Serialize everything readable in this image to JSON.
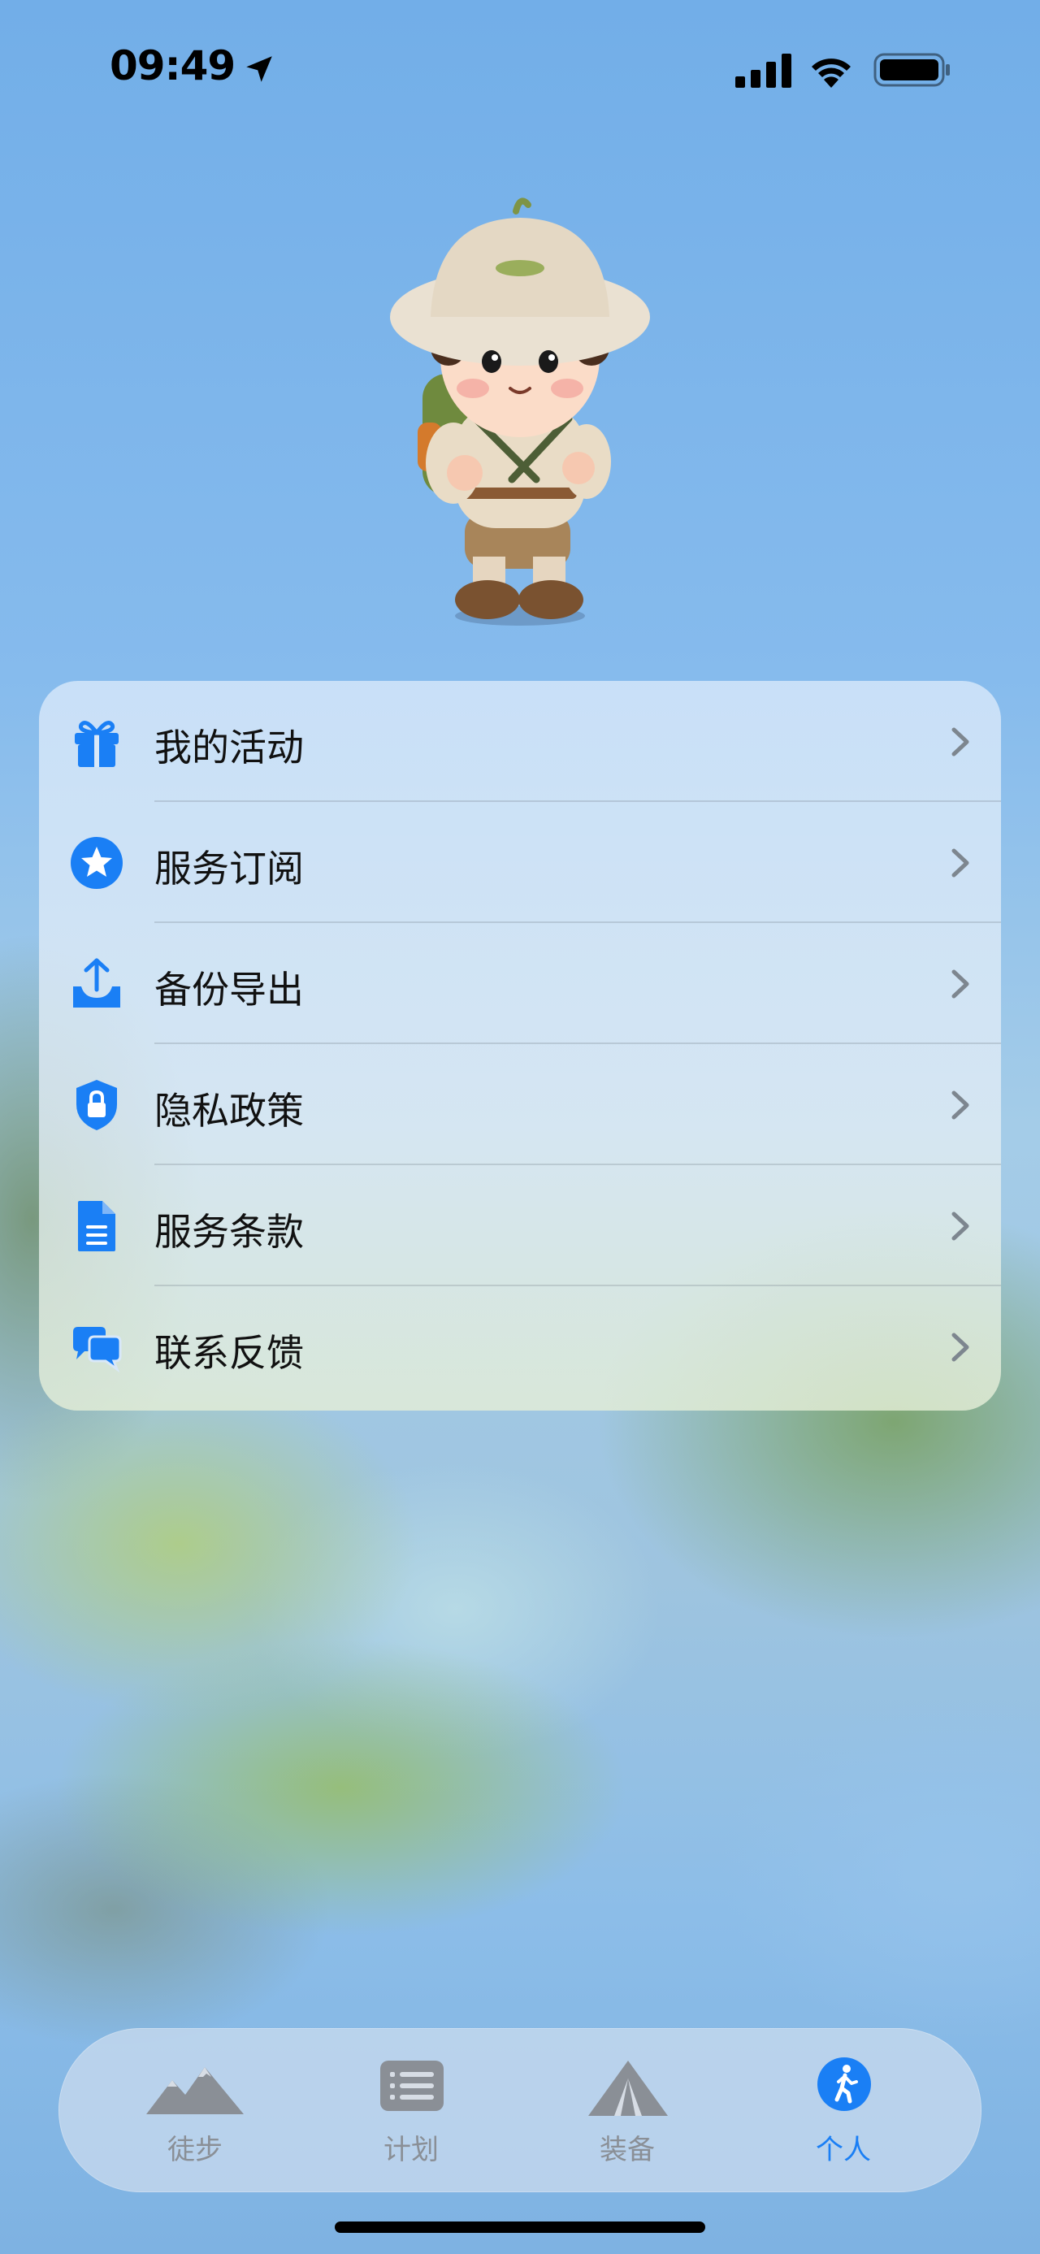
{
  "status_bar": {
    "time": "09:49"
  },
  "menu": {
    "items": [
      {
        "label": "我的活动",
        "icon": "gift-icon"
      },
      {
        "label": "服务订阅",
        "icon": "star-circle-icon"
      },
      {
        "label": "备份导出",
        "icon": "tray-upload-icon"
      },
      {
        "label": "隐私政策",
        "icon": "lock-shield-icon"
      },
      {
        "label": "服务条款",
        "icon": "document-icon"
      },
      {
        "label": "联系反馈",
        "icon": "chat-bubbles-icon"
      }
    ]
  },
  "tab_bar": {
    "tabs": [
      {
        "label": "徒步",
        "icon": "mountains-icon",
        "active": false
      },
      {
        "label": "计划",
        "icon": "list-icon",
        "active": false
      },
      {
        "label": "装备",
        "icon": "tent-icon",
        "active": false
      },
      {
        "label": "个人",
        "icon": "person-walking-icon",
        "active": true
      }
    ]
  },
  "colors": {
    "accent": "#1a7ff5",
    "inactive": "#8a8f96"
  }
}
